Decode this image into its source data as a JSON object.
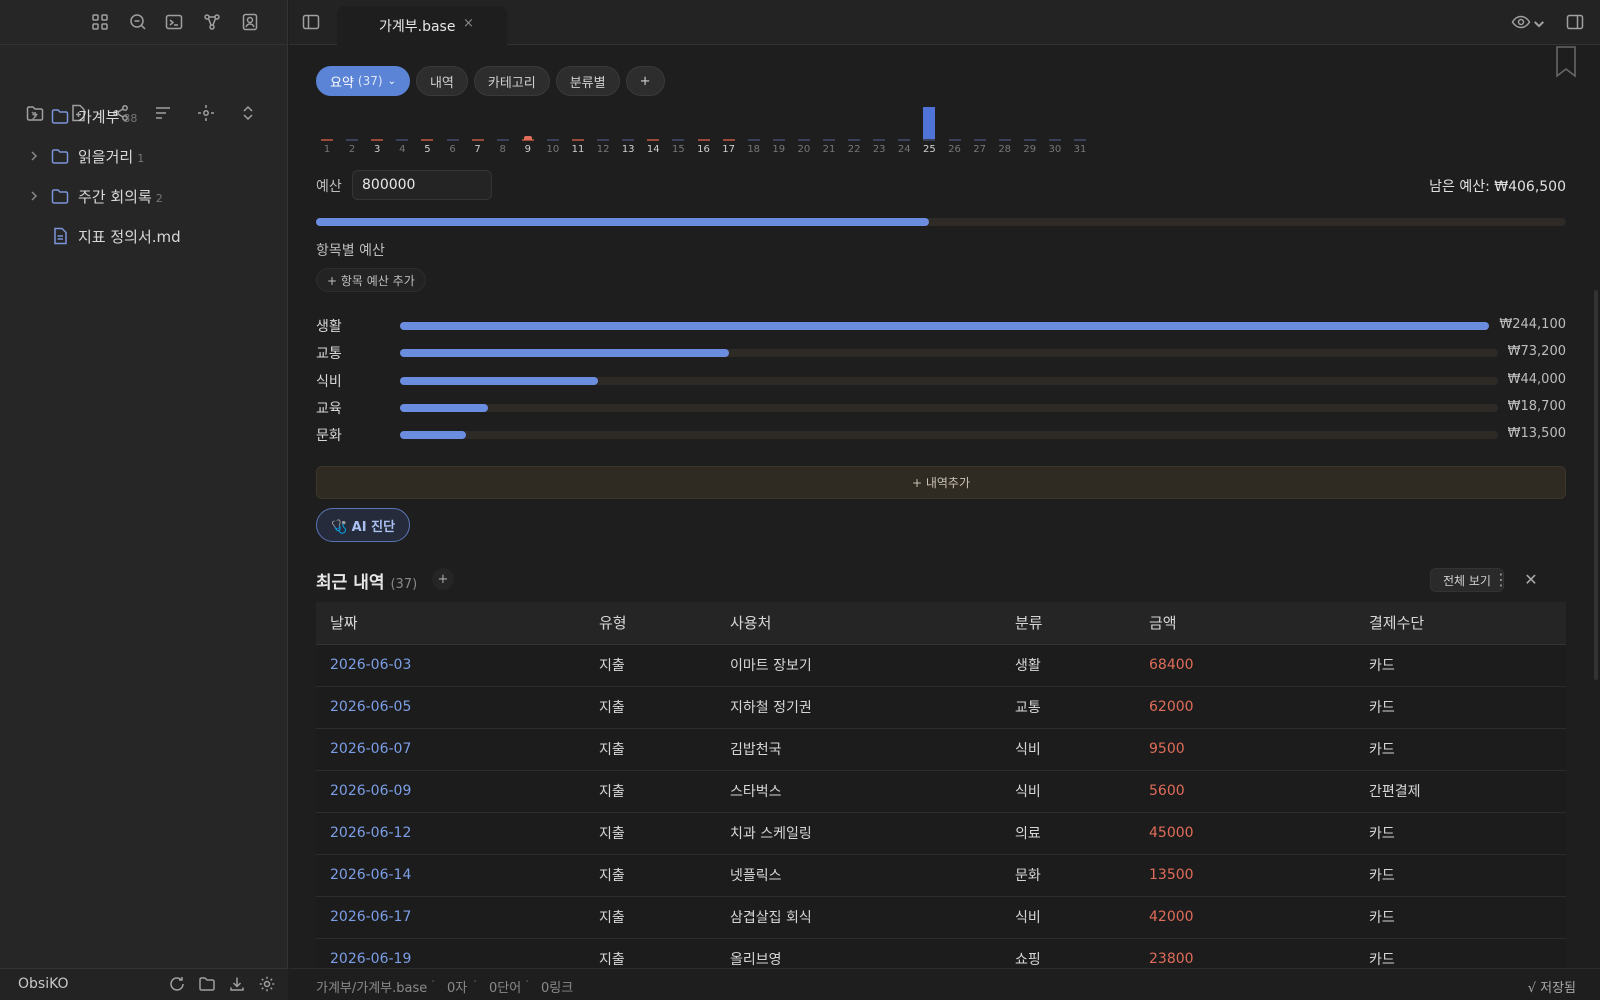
{
  "colors": {
    "accent": "#5b84d6",
    "expense": "#e06c5a",
    "link": "#7c9ee6",
    "track": "#2e2a26"
  },
  "sidebar": {
    "tree": [
      {
        "label": "가계부",
        "count": "38",
        "type": "folder"
      },
      {
        "label": "읽을거리",
        "count": "1",
        "type": "folder"
      },
      {
        "label": "주간 회의록",
        "count": "2",
        "type": "folder"
      },
      {
        "label": "지표 정의서.md",
        "count": "",
        "type": "file"
      }
    ],
    "vault_name": "ObsiKO"
  },
  "tabs": [
    {
      "label": "가계부.base",
      "close": "×"
    }
  ],
  "views": [
    {
      "label": "요약",
      "count": "(37)",
      "active": true
    },
    {
      "label": "내역"
    },
    {
      "label": "카테고리"
    },
    {
      "label": "분류별"
    },
    {
      "label": "+"
    }
  ],
  "daily_chart": {
    "days": [
      "1",
      "2",
      "3",
      "4",
      "5",
      "6",
      "7",
      "8",
      "9",
      "10",
      "11",
      "12",
      "13",
      "14",
      "15",
      "16",
      "17",
      "18",
      "19",
      "20",
      "21",
      "22",
      "23",
      "24",
      "25",
      "26",
      "27",
      "28",
      "29",
      "30",
      "31"
    ],
    "bold_days": [
      "3",
      "5",
      "7",
      "9",
      "11",
      "13",
      "14",
      "16",
      "17",
      "25"
    ],
    "peak_day": "25",
    "income_bar_level": [
      0,
      0,
      0,
      0,
      0,
      0,
      0,
      0,
      0,
      0,
      0,
      0,
      0,
      0,
      0,
      0,
      0,
      0,
      0,
      0,
      0,
      0,
      0,
      0,
      1,
      0,
      0,
      0,
      0,
      0,
      0
    ],
    "expense_marked_days": [
      "1",
      "3",
      "5",
      "7",
      "9",
      "11",
      "14",
      "16",
      "17"
    ]
  },
  "budget": {
    "label": "예산",
    "value": "800000",
    "remaining_label": "남은 예산: ₩406,500",
    "used_fraction": 0.49
  },
  "category_budget": {
    "title": "항목별 예산",
    "add_label": "+ 항목 예산 추가",
    "items": [
      {
        "name": "생활",
        "amount": "₩244,100",
        "fraction": 1.0
      },
      {
        "name": "교통",
        "amount": "₩73,200",
        "fraction": 0.3
      },
      {
        "name": "식비",
        "amount": "₩44,000",
        "fraction": 0.18
      },
      {
        "name": "교육",
        "amount": "₩18,700",
        "fraction": 0.08
      },
      {
        "name": "문화",
        "amount": "₩13,500",
        "fraction": 0.06
      }
    ]
  },
  "add_entry_label": "+ 내역추가",
  "ai_button_label": "🩺 AI 진단",
  "recent": {
    "title": "최근 내역",
    "count": "(37)",
    "plus": "+",
    "view_all": "전체 보기",
    "columns": [
      "날짜",
      "유형",
      "사용처",
      "분류",
      "금액",
      "결제수단"
    ],
    "rows": [
      [
        "2026-06-03",
        "지출",
        "이마트 장보기",
        "생활",
        "68400",
        "카드"
      ],
      [
        "2026-06-05",
        "지출",
        "지하철 정기권",
        "교통",
        "62000",
        "카드"
      ],
      [
        "2026-06-07",
        "지출",
        "김밥천국",
        "식비",
        "9500",
        "카드"
      ],
      [
        "2026-06-09",
        "지출",
        "스타벅스",
        "식비",
        "5600",
        "간편결제"
      ],
      [
        "2026-06-12",
        "지출",
        "치과 스케일링",
        "의료",
        "45000",
        "카드"
      ],
      [
        "2026-06-14",
        "지출",
        "넷플릭스",
        "문화",
        "13500",
        "카드"
      ],
      [
        "2026-06-17",
        "지출",
        "삼겹살집 회식",
        "식비",
        "42000",
        "카드"
      ],
      [
        "2026-06-19",
        "지출",
        "올리브영",
        "쇼핑",
        "23800",
        "카드"
      ]
    ]
  },
  "status": {
    "path": "가계부/가계부.base",
    "chars": "0자",
    "words": "0단어",
    "links": "0링크",
    "saved": "√ 저장됨"
  }
}
